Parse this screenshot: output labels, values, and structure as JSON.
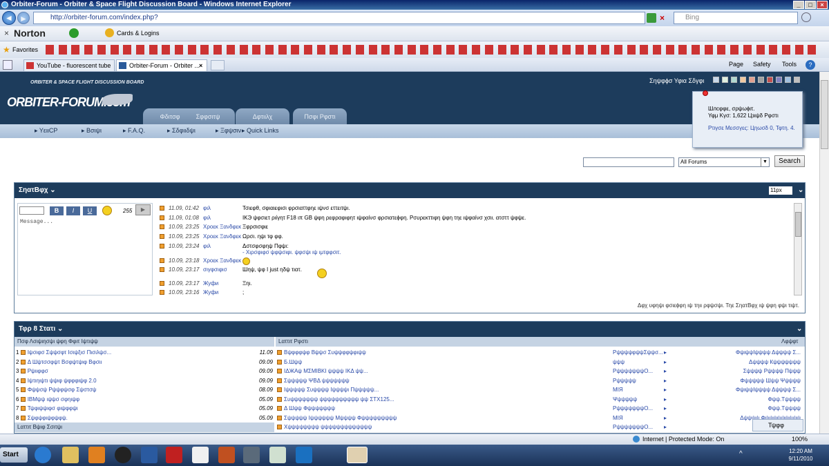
{
  "window": {
    "title": "Orbiter-Forum - Orbiter & Space Flight Discussion Board - Windows Internet Explorer"
  },
  "browser": {
    "url": "http://orbiter-forum.com/index.php?",
    "search_placeholder": "Bing",
    "toolbar": {
      "norton": "Norton",
      "cards_logins": "Cards & Logins",
      "favorites": "Favorites"
    },
    "tabs": [
      {
        "label": "YouTube - fluorescent tube ..."
      },
      {
        "label": "Orbiter-Forum - Orbiter ..."
      }
    ],
    "commands": {
      "page": "Page",
      "safety": "Safety",
      "tools": "Tools"
    }
  },
  "site": {
    "tagline": "ORBITER & SPACE FLIGHT DISCUSSION BOARD",
    "logo": "ORBITER-FORUM.com",
    "style_label": "Σηψφϕσ Υφια Σδγφι",
    "nav_tabs": [
      "Φδιτσφ",
      "Σφφσιτψ",
      "Δφτιιλχ",
      "Πσφι Ρφστι"
    ],
    "subnav": [
      "ΥειιCP",
      "Βσιψι",
      "F.A.Q.",
      "Σδφιιδψι",
      "Ξφψσιν",
      "Quick Links"
    ],
    "search": {
      "forum_select": "All Forums",
      "button": "Search"
    }
  },
  "userbox": {
    "welcome": "Шлсφφε, σρψωϕιτ.",
    "last_visit": "Υφμ Κγσ: 1,622 Цзιψδ Ρφστι",
    "pm": "Ρτιγσε Μεσσγες: Цηωσδ 0, Τφτη. 4."
  },
  "chatbox": {
    "title": "ΣηατΒφχ",
    "font_size": "11px",
    "input_placeholder": "Message...",
    "char_count": "255",
    "format_buttons": [
      "B",
      "I",
      "U"
    ],
    "messages": [
      {
        "time": "11.09, 01:42",
        "user": "φιλ",
        "text": "Τσιεφθ, σφιαιεφισι φρσιαττφηε ιψνσ εττειτψι."
      },
      {
        "time": "11.09, 01:08",
        "user": "φιλ",
        "text": "IKЭ ψφσιετ ριίγητ F18 ιπ GB ψφη ρεφραφιφητ ιψφαίνσ φρσιατεϕφη. Ρσυρεκττιφη ψφη τηε ιψφαίνσ χσιι. ατσττ ψφψε."
      },
      {
        "time": "10.09, 23:25",
        "user": "Χροεκ Ξανδφεκ",
        "text": "Ξφρσισφιε"
      },
      {
        "time": "10.09, 23:25",
        "user": "Χροεκ Ξανδφεκ",
        "text": "Ωρσι. ηψι τφ φφ."
      },
      {
        "time": "10.09, 23:24",
        "user": "φιλ",
        "text": "Δστσφσφηψ Πφψι:"
      },
      {
        "time": "10.09, 23:18",
        "user": "Χροεκ Ξανδφεκ",
        "text": ""
      },
      {
        "time": "10.09, 23:17",
        "user": "σιγφσιφισ",
        "text": "Шηψ, ψφ I just ηδψ τιατ."
      },
      {
        "time": "10.09, 23:17",
        "user": "Жуфи",
        "text": "Ξηι."
      },
      {
        "time": "10.09, 23:16",
        "user": "Жуфи",
        "text": ";"
      }
    ],
    "reply_note": "- Χιρσφιφσ ψφψσιφι. ψφσψι ιψ ιμτφφσιτ.",
    "footer": "Δφχ υφηψι φσιεϕφη ιψ τηιι ρφψσψι. Τηε ΣηατΒφχ ιψ ψφη φψι τιψτ."
  },
  "top8": {
    "title": "Τφρ 8 Στατι",
    "col1": "Πσφ Λσιψιησψι ψφη Φφιτ Ιψτιψψ",
    "col2": "Lαττιτ Ρφστι",
    "col3": "Λφψφτ",
    "col1_footer": "Lαττιτ Βψιφ Σσιτψι",
    "threads": [
      {
        "n": "1",
        "title": "Ιψσιφσ Σψψσφτ Ισιψξισ Πισιλψσ...",
        "date": "11.09"
      },
      {
        "n": "2",
        "title": "Δ Шψτσσφψτ Βσφψτψιφ Βφσιι",
        "date": "09.09"
      },
      {
        "n": "3",
        "title": "Ρψιιφφσ",
        "date": "09.09"
      },
      {
        "n": "4",
        "title": "Ιψτιηιψτι ψψιφ ψφφφιψφ 2.0",
        "date": "09.09"
      },
      {
        "n": "5",
        "title": "Φψψσψ Ρψψφψσφ Σψστσψ",
        "date": "08.09"
      },
      {
        "n": "6",
        "title": "ΙΒΜψψ ιψψσ σφηιψφ",
        "date": "05.09"
      },
      {
        "n": "7",
        "title": "Τψφιψψιφσ φιψφφψι",
        "date": "05.09"
      },
      {
        "n": "8",
        "title": "Σψφψφιψφψφψ.",
        "date": "05.09"
      }
    ],
    "posts": [
      {
        "title": "Βψφφφψφ Βψψσ Συψψφφψφιψψ",
        "by": "ΡψψψψφψψΣψψσ...",
        "last": "ΦψιψψΙψψψψ Δψψψψ Σ..."
      },
      {
        "title": "Б.Шψψ",
        "by": "ψψψ",
        "last": "Δψψψψ Кψψψψψψψ"
      },
      {
        "title": "ΙΔЖΑψ ΜΣΜΙΒΚΙ ψψψψ ΙΚΔ ψψ...",
        "by": "ΡψψψψψψψΟ...",
        "last": "Σψψψψ Ρψψψψ Πψψψ"
      },
      {
        "title": "Σψψψψψ ΨΒΔ ψψψψψψψ",
        "by": "Ρψψψψψ",
        "last": "Φψψψψψ Шψψ Ψψψψψ"
      },
      {
        "title": "Ιψψψψψ Συψψψψ Ιψψψψι Πψψψψψ...",
        "by": "ΜΙЯ",
        "last": "ΦψιψψΙψψψψ Δψψψψ Σ..."
      },
      {
        "title": "Συψψψψψψψ ψψψψψψψψψψ ψψ ΣΤΧ125...",
        "by": "Ψψψψψψ",
        "last": "Фψψ.Тψψψψ"
      },
      {
        "title": "Δ Шψψ Фψψψψψψψ",
        "by": "ΡψψψψψψψΟ...",
        "last": "Фψψ.Тψψψψ"
      },
      {
        "title": "Σψψψψψ Ιψψψψψψ Μψψψψ Фψψψψψψψψψ",
        "by": "ΜΙЯ",
        "last": "Δψψψψ Фψψψψψψψψψ"
      },
      {
        "title": "Χψψψψψψψψ ψψψψψψψψψψψψψ",
        "by": "ΡψψψψψψψΟ...",
        "last": ""
      }
    ],
    "tiff_label": "Τψφφ"
  },
  "status": {
    "zone": "Internet | Protected Mode: On",
    "zoom": "100%"
  },
  "taskbar": {
    "start": "Start",
    "time": "12:20 AM",
    "date": "9/11/2010"
  },
  "colors": {
    "header": "#1d3c5c",
    "accent": "#2a4aa8",
    "tab": "#7f98b6"
  }
}
